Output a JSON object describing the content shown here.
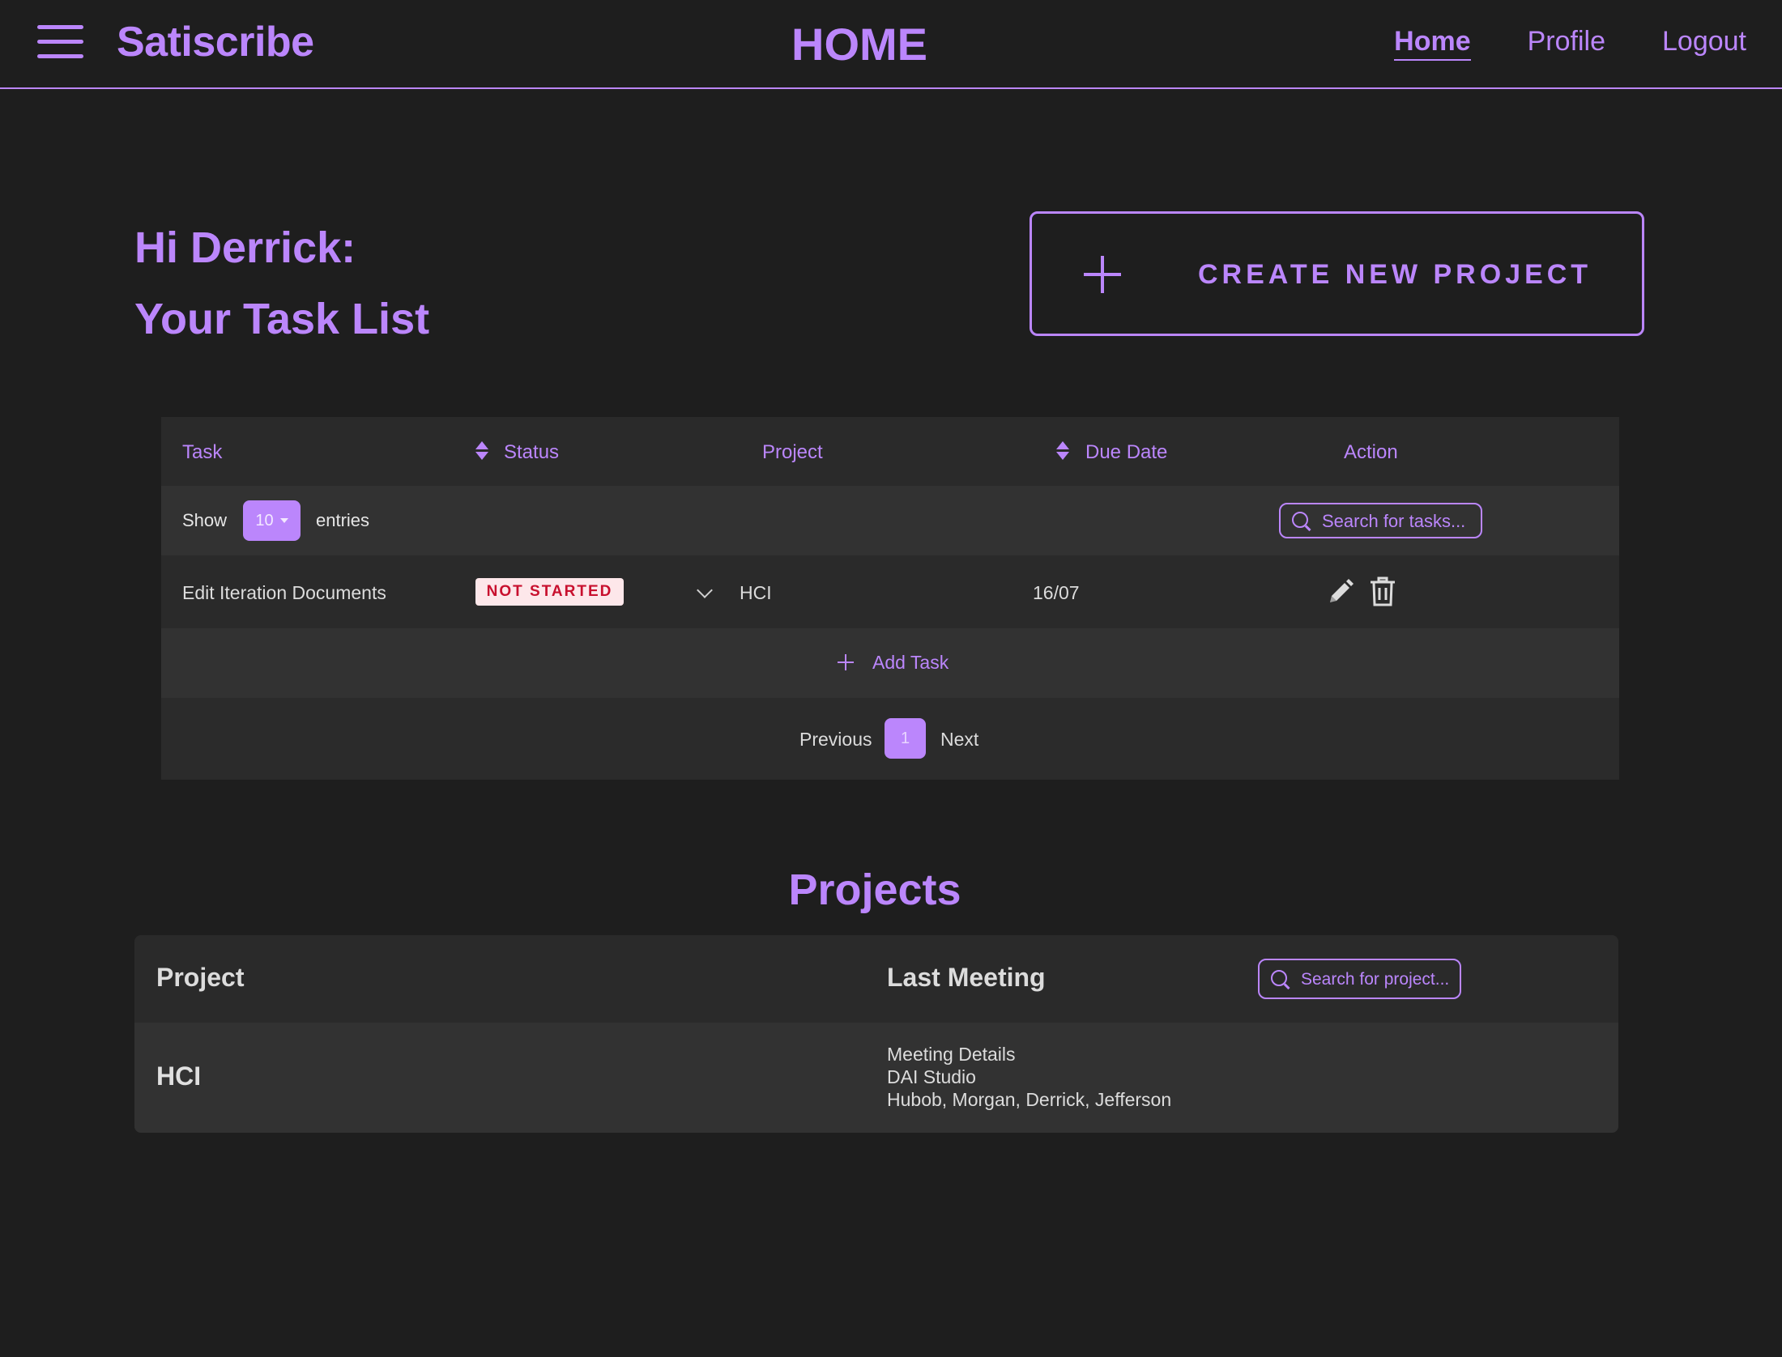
{
  "header": {
    "brand": "Satiscribe",
    "page_title": "HOME",
    "nav": [
      {
        "label": "Home",
        "active": true
      },
      {
        "label": "Profile",
        "active": false
      },
      {
        "label": "Logout",
        "active": false
      }
    ]
  },
  "greeting": {
    "line1": "Hi Derrick:",
    "line2": "Your Task List"
  },
  "create_project": {
    "label": "CREATE NEW PROJECT",
    "icon": "plus-icon"
  },
  "task_table": {
    "columns": [
      "Task",
      "Status",
      "Project",
      "Due Date",
      "Action"
    ],
    "show_label": "Show",
    "entries_value": "10",
    "entries_label": "entries",
    "search_placeholder": "Search for tasks...",
    "rows": [
      {
        "task": "Edit Iteration Documents",
        "status": "NOT STARTED",
        "project": "HCI",
        "due_date": "16/07"
      }
    ],
    "add_task_label": "Add Task",
    "pager": {
      "previous": "Previous",
      "current_page": "1",
      "next": "Next"
    }
  },
  "projects": {
    "title": "Projects",
    "columns": [
      "Project",
      "Last Meeting"
    ],
    "search_placeholder": "Search for project...",
    "rows": [
      {
        "name": "HCI",
        "meeting_title": "Meeting Details",
        "meeting_location": "DAI Studio",
        "meeting_attendees": "Hubob, Morgan, Derrick, Jefferson"
      }
    ]
  },
  "colors": {
    "accent": "#bb86fc",
    "background": "#1e1e1e",
    "status_not_started_bg": "#fde7ea",
    "status_not_started_text": "#c8102e"
  }
}
